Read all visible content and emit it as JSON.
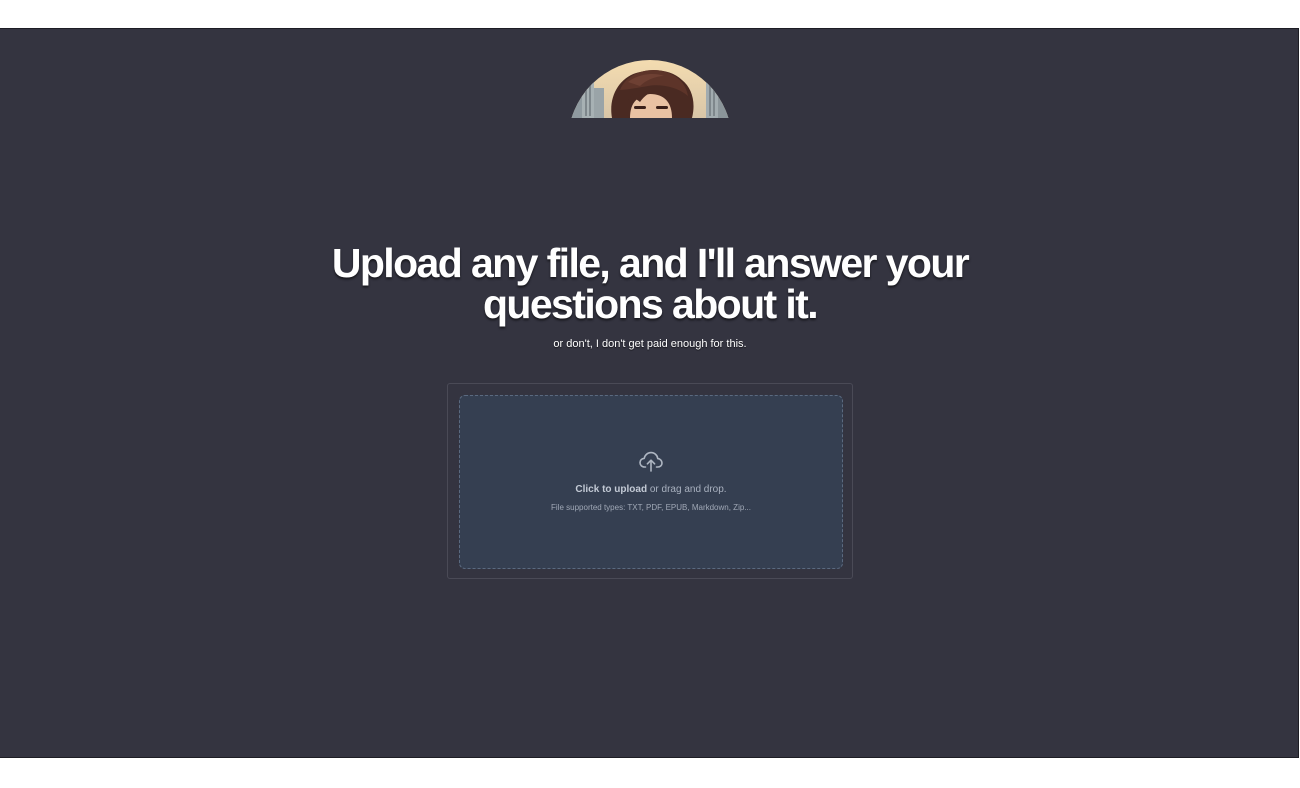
{
  "hero": {
    "title": "Upload any file, and I'll answer your questions about it.",
    "subtitle": "or don't, I don't get paid enough for this."
  },
  "avatar": {
    "icon": "avatar-illustration"
  },
  "upload": {
    "icon": "cloud-upload-icon",
    "click_label": "Click to upload",
    "drag_label": " or drag and drop.",
    "types_label": "File supported types: TXT, PDF, EPUB, Markdown, Zip..."
  },
  "colors": {
    "page_background": "#343440",
    "dropzone_background": "#353f51",
    "dropzone_border": "#5b6a80",
    "title_text": "#ffffff"
  }
}
